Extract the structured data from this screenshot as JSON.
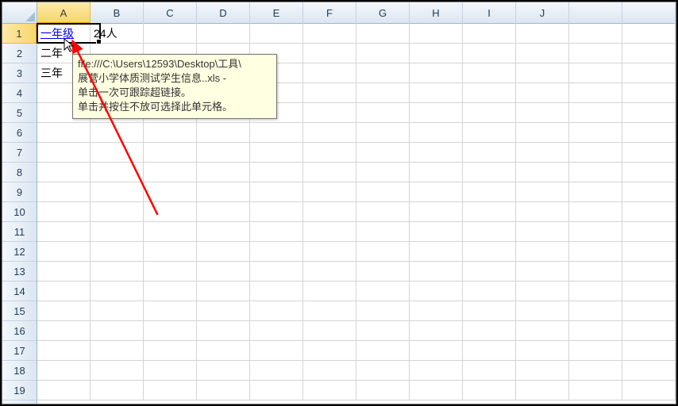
{
  "columns": [
    "A",
    "B",
    "C",
    "D",
    "E",
    "F",
    "G",
    "H",
    "I",
    "J"
  ],
  "rows": [
    "1",
    "2",
    "3",
    "4",
    "5",
    "6",
    "7",
    "8",
    "9",
    "10",
    "11",
    "12",
    "13",
    "14",
    "15",
    "16",
    "17",
    "18",
    "19"
  ],
  "active": {
    "col": 0,
    "row": 0
  },
  "cells": {
    "A1": "一年级",
    "B1": "24人",
    "A2": "二年",
    "A3": "三年"
  },
  "hyperlinks": [
    "A1"
  ],
  "tooltip": {
    "line1": "file:///C:\\Users\\12593\\Desktop\\工具\\",
    "line2": "展营小学体质测试学生信息..xls - ",
    "line3": "单击一次可跟踪超链接。",
    "line4": "单击并按住不放可选择此单元格。"
  }
}
